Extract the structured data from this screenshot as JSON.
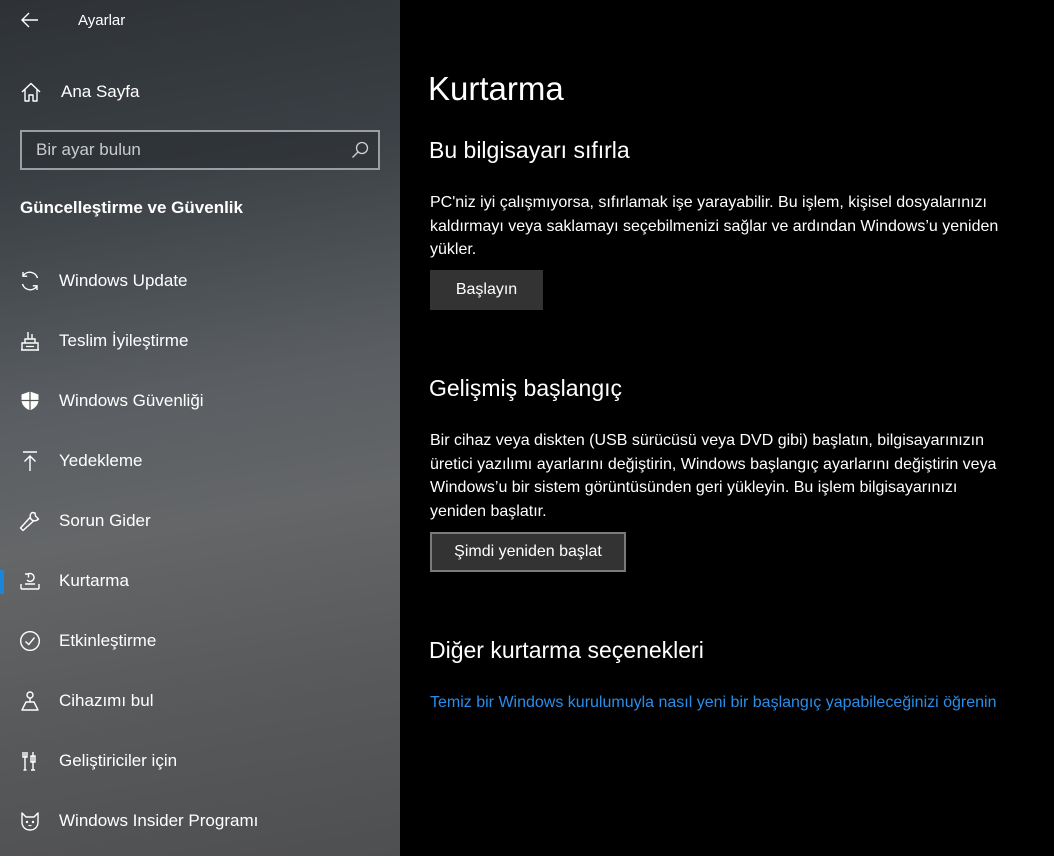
{
  "window": {
    "title": "Ayarlar"
  },
  "sidebar": {
    "home_label": "Ana Sayfa",
    "search_placeholder": "Bir ayar bulun",
    "section_title": "Güncelleştirme ve Güvenlik",
    "items": [
      {
        "label": "Windows Update",
        "icon": "sync-icon"
      },
      {
        "label": "Teslim İyileştirme",
        "icon": "delivery-optimization-icon"
      },
      {
        "label": "Windows Güvenliği",
        "icon": "shield-icon"
      },
      {
        "label": "Yedekleme",
        "icon": "backup-upload-icon"
      },
      {
        "label": "Sorun Gider",
        "icon": "wrench-icon"
      },
      {
        "label": "Kurtarma",
        "icon": "recovery-icon",
        "selected": true
      },
      {
        "label": "Etkinleştirme",
        "icon": "check-circle-icon"
      },
      {
        "label": "Cihazımı bul",
        "icon": "find-device-icon"
      },
      {
        "label": "Geliştiriciler için",
        "icon": "developer-tools-icon"
      },
      {
        "label": "Windows Insider Programı",
        "icon": "insider-cat-icon"
      }
    ]
  },
  "main": {
    "title": "Kurtarma",
    "reset": {
      "heading": "Bu bilgisayarı sıfırla",
      "description": "PC'niz iyi çalışmıyorsa, sıfırlamak işe yarayabilir. Bu işlem, kişisel dosyalarınızı kaldırmayı veya saklamayı seçebilmenizi sağlar ve ardından Windows’u yeniden yükler.",
      "button_label": "Başlayın"
    },
    "advanced": {
      "heading": "Gelişmiş başlangıç",
      "description": "Bir cihaz veya diskten (USB sürücüsü veya DVD gibi) başlatın, bilgisayarınızın üretici yazılımı ayarlarını değiştirin, Windows başlangıç ayarlarını değiştirin veya Windows’u bir sistem görüntüsünden geri yükleyin. Bu işlem bilgisayarınızı yeniden başlatır.",
      "button_label": "Şimdi yeniden başlat"
    },
    "more": {
      "heading": "Diğer kurtarma seçenekleri",
      "link_text": "Temiz bir Windows kurulumuyla nasıl yeni bir başlangıç yapabileceğinizi öğrenin"
    }
  },
  "colors": {
    "accent": "#1a86d9",
    "link": "#2a8de8",
    "button": "#333333",
    "background": "#000000"
  }
}
